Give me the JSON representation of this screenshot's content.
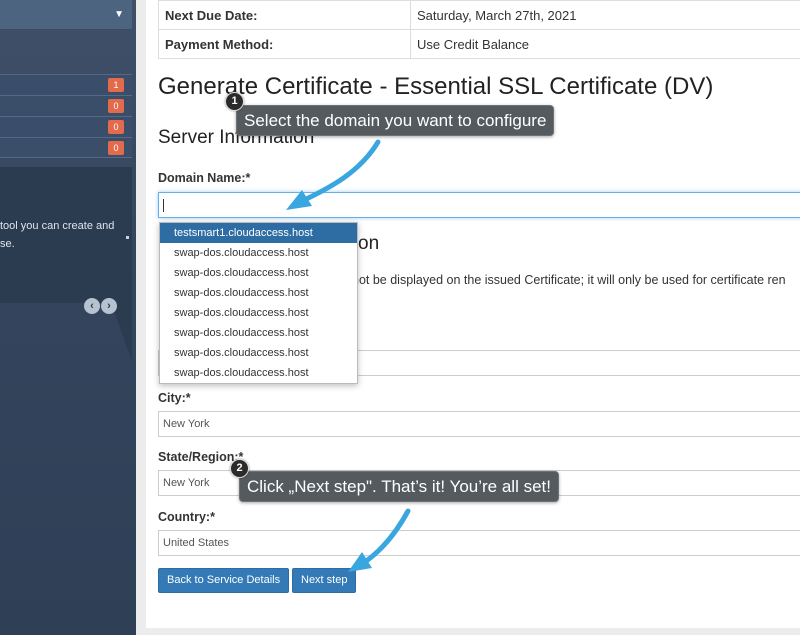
{
  "sidebar": {
    "badges": [
      "1",
      "0",
      "0",
      "0"
    ],
    "description_lines": [
      "tool you can create and",
      "se."
    ]
  },
  "info": [
    {
      "label": "Next Due Date:",
      "value": "Saturday, March 27th, 2021"
    },
    {
      "label": "Payment Method:",
      "value": "Use Credit Balance"
    }
  ],
  "title": "Generate Certificate - Essential SSL Certificate (DV)",
  "server_info_heading": "Server Information",
  "hidden_heading_tail": "on",
  "domain": {
    "label": "Domain Name:*",
    "options": [
      "testsmart1.cloudaccess.host",
      "swap-dos.cloudaccess.host",
      "swap-dos.cloudaccess.host",
      "swap-dos.cloudaccess.host",
      "swap-dos.cloudaccess.host",
      "swap-dos.cloudaccess.host",
      "swap-dos.cloudaccess.host",
      "swap-dos.cloudaccess.host"
    ]
  },
  "notice_text": "not be displayed on the issued Certificate; it will only be used for certificate ren",
  "fields": {
    "city_label": "City:*",
    "city_value": "New York",
    "state_label": "State/Region:*",
    "state_value": "New York",
    "country_label": "Country:*",
    "country_value": "United States"
  },
  "buttons": {
    "back": "Back to Service Details",
    "next": "Next step"
  },
  "tooltips": {
    "step1_number": "1",
    "step1_text": "Select the domain you want to configure",
    "step2_number": "2",
    "step2_text": "Click „Next step\". That’s it! You’re all set!"
  },
  "colors": {
    "primary_button": "#337ab7",
    "badge": "#e46a4c",
    "arrow": "#3aa6e0",
    "sidebar": "#34455d"
  }
}
